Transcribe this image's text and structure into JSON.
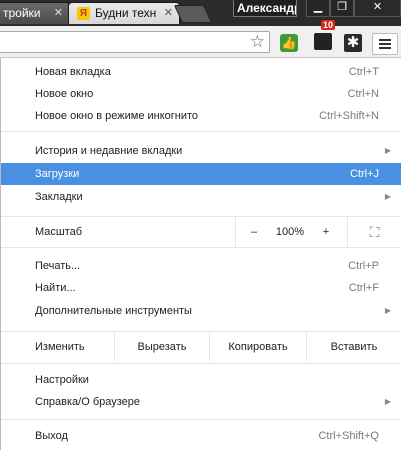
{
  "tabs": [
    {
      "title": "тройки",
      "active": false
    },
    {
      "title": "Будни техн",
      "active": true
    },
    {
      "title": "",
      "active": false
    }
  ],
  "user_name": "Александр",
  "window_controls": [
    "minimize",
    "restore",
    "close"
  ],
  "toolbar": {
    "extension_badge": "10",
    "icons": [
      "bookmark-star-icon",
      "green-extension-icon",
      "dark-extension-icon",
      "snowflake-extension-icon",
      "menu-icon"
    ]
  },
  "menu": {
    "highlight_color": "#4a90e2",
    "group1": [
      {
        "label": "Новая вкладка",
        "shortcut": "Ctrl+T"
      },
      {
        "label": "Новое окно",
        "shortcut": "Ctrl+N"
      },
      {
        "label": "Новое окно в режиме инкогнито",
        "shortcut": "Ctrl+Shift+N"
      }
    ],
    "group2": [
      {
        "label": "История и недавние вкладки",
        "shortcut": "",
        "submenu": true
      },
      {
        "label": "Загрузки",
        "shortcut": "Ctrl+J",
        "highlighted": true
      },
      {
        "label": "Закладки",
        "shortcut": "",
        "submenu": true
      }
    ],
    "zoom": {
      "label": "Масштаб",
      "minus": "–",
      "value": "100%",
      "plus": "+"
    },
    "group3": [
      {
        "label": "Печать...",
        "shortcut": "Ctrl+P"
      },
      {
        "label": "Найти...",
        "shortcut": "Ctrl+F"
      },
      {
        "label": "Дополнительные инструменты",
        "shortcut": "",
        "submenu": true
      }
    ],
    "edit": {
      "label": "Изменить",
      "cut": "Вырезать",
      "copy": "Копировать",
      "paste": "Вставить"
    },
    "group4": [
      {
        "label": "Настройки",
        "shortcut": ""
      },
      {
        "label": "Справка/О браузере",
        "shortcut": "",
        "submenu": true
      }
    ],
    "group5": [
      {
        "label": "Выход",
        "shortcut": "Ctrl+Shift+Q"
      }
    ]
  }
}
